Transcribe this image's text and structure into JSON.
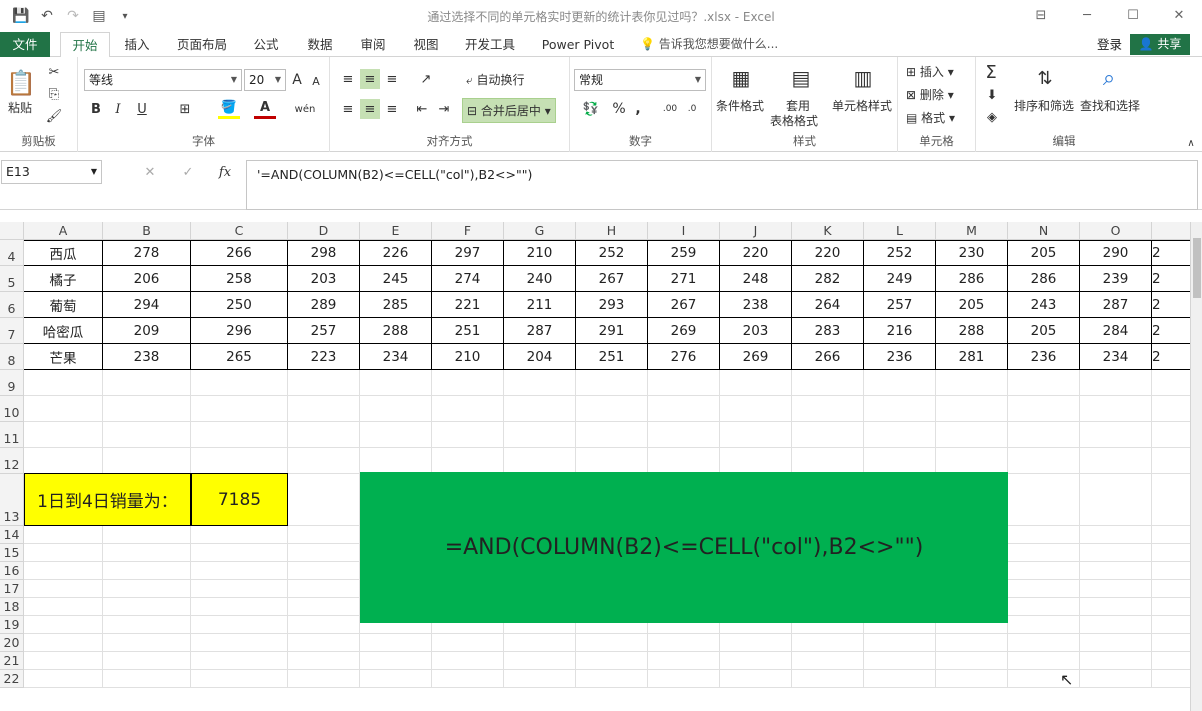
{
  "titlebar": {
    "title": "通过选择不同的单元格实时更新的统计表你见过吗？.xlsx - Excel",
    "save_icon": "💾",
    "undo_icon": "↶",
    "redo_icon": "↷",
    "form_icon": "▤",
    "customize_icon": "▾",
    "ribbon_opts_icon": "⊟",
    "min_icon": "─",
    "max_icon": "☐",
    "close_icon": "✕"
  },
  "tabs": {
    "file": "文件",
    "items": [
      "开始",
      "插入",
      "页面布局",
      "公式",
      "数据",
      "审阅",
      "视图",
      "开发工具",
      "Power Pivot"
    ],
    "tellme": "告诉我您想要做什么...",
    "login": "登录",
    "share": "共享"
  },
  "ribbon": {
    "clipboard": {
      "label": "剪贴板",
      "paste": "粘贴"
    },
    "font": {
      "label": "字体",
      "name": "等线",
      "size": "20",
      "grow": "A",
      "shrink": "A",
      "bold": "B",
      "italic": "I",
      "underline": "U",
      "wen": "wén"
    },
    "align": {
      "label": "对齐方式",
      "wrap": "自动换行",
      "merge": "合并后居中"
    },
    "number": {
      "label": "数字",
      "format": "常规",
      "percent": "%",
      "comma": ","
    },
    "styles": {
      "label": "样式",
      "cond": "条件格式",
      "table1": "套用",
      "table2": "表格格式",
      "cellstyle": "单元格样式"
    },
    "cells": {
      "label": "单元格",
      "insert": "插入",
      "delete": "删除",
      "format": "格式"
    },
    "edit": {
      "label": "编辑",
      "sum": "Σ",
      "sort": "排序和筛选",
      "find": "查找和选择"
    }
  },
  "formula_bar": {
    "cell_ref": "E13",
    "fx": "fx",
    "formula": "'=AND(COLUMN(B2)<=CELL(\"col\"),B2<>\"\")",
    "cancel": "✕",
    "confirm": "✓"
  },
  "columns": [
    "A",
    "B",
    "C",
    "D",
    "E",
    "F",
    "G",
    "H",
    "I",
    "J",
    "K",
    "L",
    "M",
    "N",
    "O"
  ],
  "rows": [
    {
      "n": "4",
      "cells": [
        "西瓜",
        "278",
        "266",
        "298",
        "226",
        "297",
        "210",
        "252",
        "259",
        "220",
        "220",
        "252",
        "230",
        "205",
        "290",
        "2"
      ]
    },
    {
      "n": "5",
      "cells": [
        "橘子",
        "206",
        "258",
        "203",
        "245",
        "274",
        "240",
        "267",
        "271",
        "248",
        "282",
        "249",
        "286",
        "286",
        "239",
        "2"
      ]
    },
    {
      "n": "6",
      "cells": [
        "葡萄",
        "294",
        "250",
        "289",
        "285",
        "221",
        "211",
        "293",
        "267",
        "238",
        "264",
        "257",
        "205",
        "243",
        "287",
        "2"
      ]
    },
    {
      "n": "7",
      "cells": [
        "哈密瓜",
        "209",
        "296",
        "257",
        "288",
        "251",
        "287",
        "291",
        "269",
        "203",
        "283",
        "216",
        "288",
        "205",
        "284",
        "2"
      ]
    },
    {
      "n": "8",
      "cells": [
        "芒果",
        "238",
        "265",
        "223",
        "234",
        "210",
        "204",
        "251",
        "276",
        "269",
        "266",
        "236",
        "281",
        "236",
        "234",
        "2"
      ]
    }
  ],
  "empty_rows": [
    "9",
    "10",
    "11",
    "12",
    "13",
    "14",
    "15",
    "16",
    "17",
    "18",
    "19",
    "20",
    "21",
    "22"
  ],
  "summary": {
    "label": "1日到4日销量为：",
    "value": "7185"
  },
  "green_box": {
    "text": "=AND(COLUMN(B2)<=CELL(\"col\"),B2<>\"\")"
  },
  "colors": {
    "excel_green": "#217346",
    "yellow": "#ffff00",
    "green_box": "#00b050"
  }
}
